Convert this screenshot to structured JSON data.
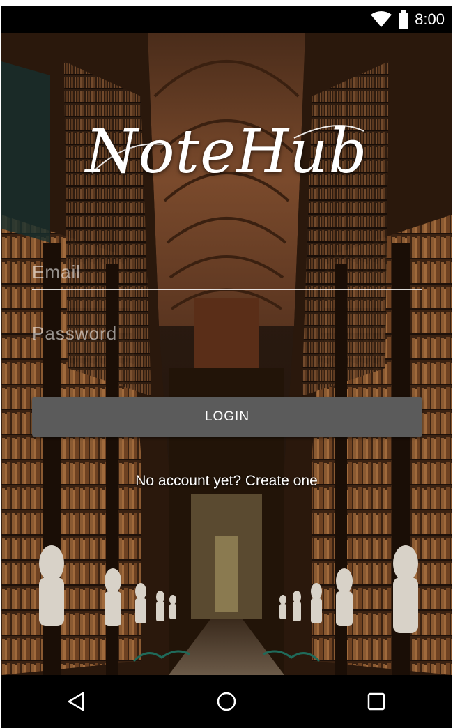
{
  "status_bar": {
    "time": "8:00",
    "icons": [
      "wifi-icon",
      "battery-icon"
    ]
  },
  "app": {
    "logo_text": "NoteHub"
  },
  "form": {
    "email_placeholder": "Email",
    "email_value": "",
    "password_placeholder": "Password",
    "password_value": "",
    "login_label": "LOGIN",
    "create_account_text": "No account yet? Create one"
  },
  "nav_bar": {
    "icons": [
      "back-icon",
      "home-icon",
      "recents-icon"
    ]
  },
  "colors": {
    "button_bg": "#5b5b5b",
    "text": "#ffffff",
    "bars": "#000000"
  }
}
